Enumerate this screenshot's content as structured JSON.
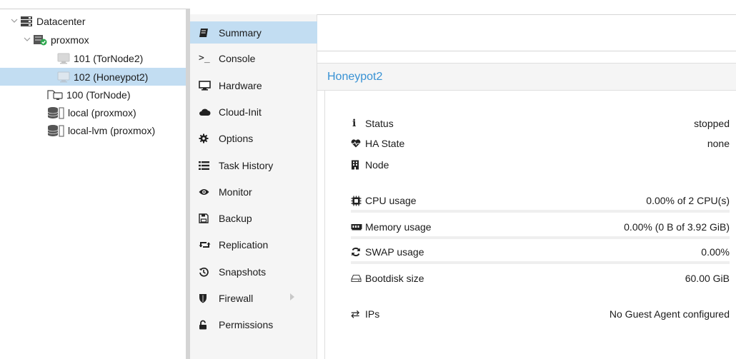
{
  "tree": {
    "items": [
      {
        "label": "Datacenter",
        "icon": "server-rack-icon"
      },
      {
        "label": "proxmox",
        "icon": "node-online-icon"
      },
      {
        "label": "101 (TorNode2)",
        "icon": "vm-stopped-icon"
      },
      {
        "label": "102 (Honeypot2)",
        "icon": "vm-stopped-icon"
      },
      {
        "label": "100 (TorNode)",
        "icon": "vm-template-icon"
      },
      {
        "label": "local (proxmox)",
        "icon": "storage-icon"
      },
      {
        "label": "local-lvm (proxmox)",
        "icon": "storage-icon"
      }
    ]
  },
  "nav": {
    "items": [
      {
        "label": "Summary",
        "icon": "book-icon"
      },
      {
        "label": "Console",
        "icon": "terminal-icon",
        "glyph": ">_"
      },
      {
        "label": "Hardware",
        "icon": "desktop-icon"
      },
      {
        "label": "Cloud-Init",
        "icon": "cloud-icon"
      },
      {
        "label": "Options",
        "icon": "gear-icon"
      },
      {
        "label": "Task History",
        "icon": "list-icon"
      },
      {
        "label": "Monitor",
        "icon": "eye-icon"
      },
      {
        "label": "Backup",
        "icon": "floppy-icon"
      },
      {
        "label": "Replication",
        "icon": "retweet-icon"
      },
      {
        "label": "Snapshots",
        "icon": "history-icon"
      },
      {
        "label": "Firewall",
        "icon": "shield-icon"
      },
      {
        "label": "Permissions",
        "icon": "unlock-icon"
      }
    ]
  },
  "panel": {
    "title": "Honeypot2",
    "rows": [
      {
        "label": "Status",
        "value": "stopped",
        "icon": "info-icon",
        "glyph": "i"
      },
      {
        "label": "HA State",
        "value": "none",
        "icon": "heartbeat-icon"
      },
      {
        "label": "Node",
        "value": "",
        "icon": "building-icon"
      },
      {
        "label": "CPU usage",
        "value": "0.00% of 2 CPU(s)",
        "icon": "cpu-icon",
        "usage": 0.0
      },
      {
        "label": "Memory usage",
        "value": "0.00% (0 B of 3.92 GiB)",
        "icon": "memory-icon",
        "usage": 0.0
      },
      {
        "label": "SWAP usage",
        "value": "0.00%",
        "icon": "refresh-icon",
        "usage": 0.0
      },
      {
        "label": "Bootdisk size",
        "value": "60.00 GiB",
        "icon": "hdd-icon"
      },
      {
        "label": "IPs",
        "value": "No Guest Agent configured",
        "icon": "exchange-icon",
        "glyph": "⇄"
      }
    ]
  },
  "colors": {
    "selected_bg": "#c2ddf2",
    "title_text": "#3892d4",
    "nav_bg": "#f5f5f5",
    "online_green": "#2fa84f"
  }
}
